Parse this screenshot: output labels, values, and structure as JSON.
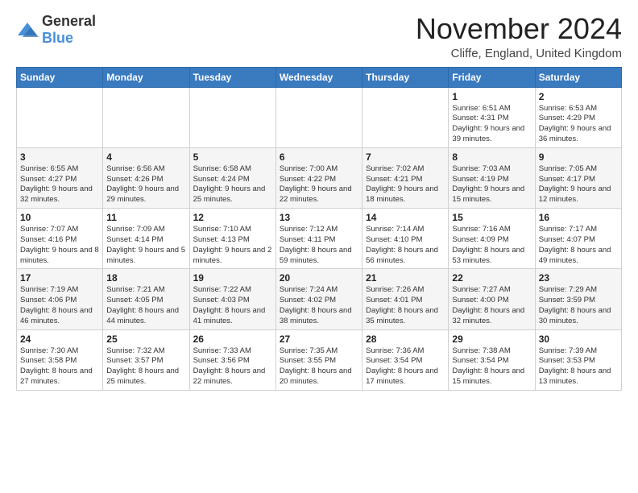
{
  "logo": {
    "general": "General",
    "blue": "Blue"
  },
  "header": {
    "month": "November 2024",
    "location": "Cliffe, England, United Kingdom"
  },
  "weekdays": [
    "Sunday",
    "Monday",
    "Tuesday",
    "Wednesday",
    "Thursday",
    "Friday",
    "Saturday"
  ],
  "weeks": [
    [
      {
        "day": "",
        "info": ""
      },
      {
        "day": "",
        "info": ""
      },
      {
        "day": "",
        "info": ""
      },
      {
        "day": "",
        "info": ""
      },
      {
        "day": "",
        "info": ""
      },
      {
        "day": "1",
        "info": "Sunrise: 6:51 AM\nSunset: 4:31 PM\nDaylight: 9 hours\nand 39 minutes."
      },
      {
        "day": "2",
        "info": "Sunrise: 6:53 AM\nSunset: 4:29 PM\nDaylight: 9 hours\nand 36 minutes."
      }
    ],
    [
      {
        "day": "3",
        "info": "Sunrise: 6:55 AM\nSunset: 4:27 PM\nDaylight: 9 hours\nand 32 minutes."
      },
      {
        "day": "4",
        "info": "Sunrise: 6:56 AM\nSunset: 4:26 PM\nDaylight: 9 hours\nand 29 minutes."
      },
      {
        "day": "5",
        "info": "Sunrise: 6:58 AM\nSunset: 4:24 PM\nDaylight: 9 hours\nand 25 minutes."
      },
      {
        "day": "6",
        "info": "Sunrise: 7:00 AM\nSunset: 4:22 PM\nDaylight: 9 hours\nand 22 minutes."
      },
      {
        "day": "7",
        "info": "Sunrise: 7:02 AM\nSunset: 4:21 PM\nDaylight: 9 hours\nand 18 minutes."
      },
      {
        "day": "8",
        "info": "Sunrise: 7:03 AM\nSunset: 4:19 PM\nDaylight: 9 hours\nand 15 minutes."
      },
      {
        "day": "9",
        "info": "Sunrise: 7:05 AM\nSunset: 4:17 PM\nDaylight: 9 hours\nand 12 minutes."
      }
    ],
    [
      {
        "day": "10",
        "info": "Sunrise: 7:07 AM\nSunset: 4:16 PM\nDaylight: 9 hours\nand 8 minutes."
      },
      {
        "day": "11",
        "info": "Sunrise: 7:09 AM\nSunset: 4:14 PM\nDaylight: 9 hours\nand 5 minutes."
      },
      {
        "day": "12",
        "info": "Sunrise: 7:10 AM\nSunset: 4:13 PM\nDaylight: 9 hours\nand 2 minutes."
      },
      {
        "day": "13",
        "info": "Sunrise: 7:12 AM\nSunset: 4:11 PM\nDaylight: 8 hours\nand 59 minutes."
      },
      {
        "day": "14",
        "info": "Sunrise: 7:14 AM\nSunset: 4:10 PM\nDaylight: 8 hours\nand 56 minutes."
      },
      {
        "day": "15",
        "info": "Sunrise: 7:16 AM\nSunset: 4:09 PM\nDaylight: 8 hours\nand 53 minutes."
      },
      {
        "day": "16",
        "info": "Sunrise: 7:17 AM\nSunset: 4:07 PM\nDaylight: 8 hours\nand 49 minutes."
      }
    ],
    [
      {
        "day": "17",
        "info": "Sunrise: 7:19 AM\nSunset: 4:06 PM\nDaylight: 8 hours\nand 46 minutes."
      },
      {
        "day": "18",
        "info": "Sunrise: 7:21 AM\nSunset: 4:05 PM\nDaylight: 8 hours\nand 44 minutes."
      },
      {
        "day": "19",
        "info": "Sunrise: 7:22 AM\nSunset: 4:03 PM\nDaylight: 8 hours\nand 41 minutes."
      },
      {
        "day": "20",
        "info": "Sunrise: 7:24 AM\nSunset: 4:02 PM\nDaylight: 8 hours\nand 38 minutes."
      },
      {
        "day": "21",
        "info": "Sunrise: 7:26 AM\nSunset: 4:01 PM\nDaylight: 8 hours\nand 35 minutes."
      },
      {
        "day": "22",
        "info": "Sunrise: 7:27 AM\nSunset: 4:00 PM\nDaylight: 8 hours\nand 32 minutes."
      },
      {
        "day": "23",
        "info": "Sunrise: 7:29 AM\nSunset: 3:59 PM\nDaylight: 8 hours\nand 30 minutes."
      }
    ],
    [
      {
        "day": "24",
        "info": "Sunrise: 7:30 AM\nSunset: 3:58 PM\nDaylight: 8 hours\nand 27 minutes."
      },
      {
        "day": "25",
        "info": "Sunrise: 7:32 AM\nSunset: 3:57 PM\nDaylight: 8 hours\nand 25 minutes."
      },
      {
        "day": "26",
        "info": "Sunrise: 7:33 AM\nSunset: 3:56 PM\nDaylight: 8 hours\nand 22 minutes."
      },
      {
        "day": "27",
        "info": "Sunrise: 7:35 AM\nSunset: 3:55 PM\nDaylight: 8 hours\nand 20 minutes."
      },
      {
        "day": "28",
        "info": "Sunrise: 7:36 AM\nSunset: 3:54 PM\nDaylight: 8 hours\nand 17 minutes."
      },
      {
        "day": "29",
        "info": "Sunrise: 7:38 AM\nSunset: 3:54 PM\nDaylight: 8 hours\nand 15 minutes."
      },
      {
        "day": "30",
        "info": "Sunrise: 7:39 AM\nSunset: 3:53 PM\nDaylight: 8 hours\nand 13 minutes."
      }
    ]
  ]
}
